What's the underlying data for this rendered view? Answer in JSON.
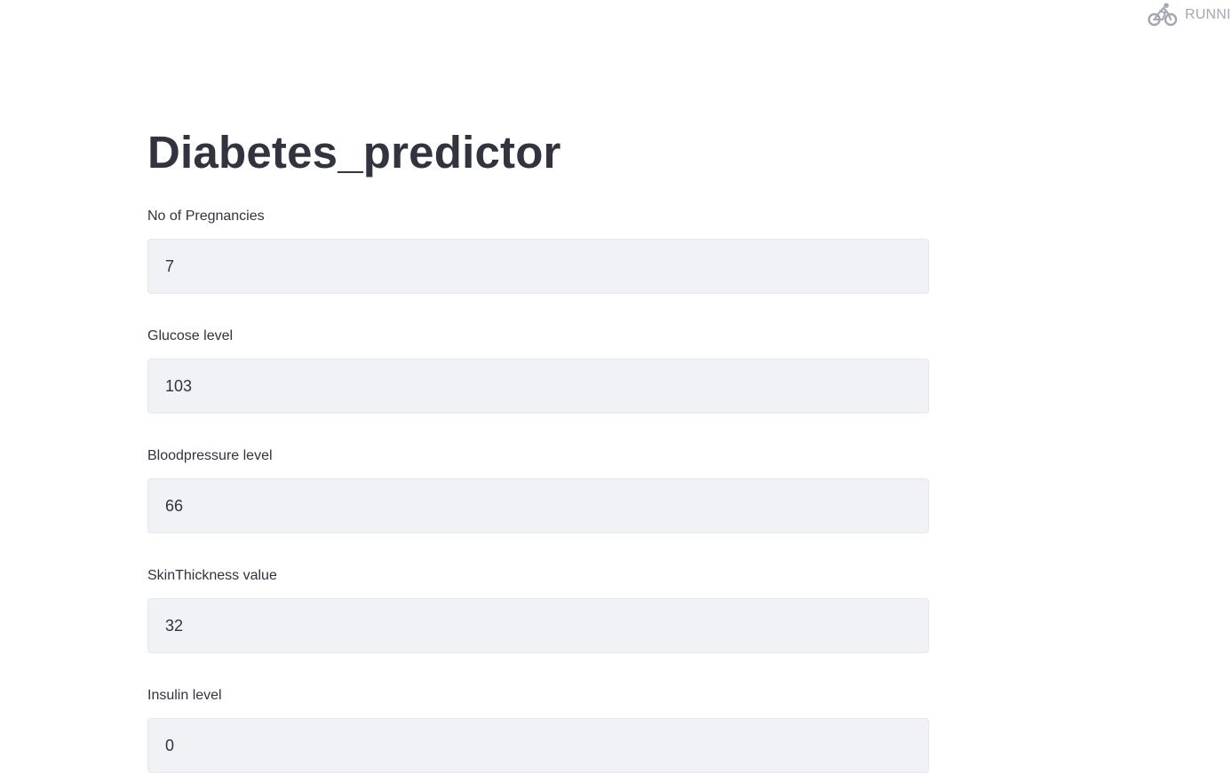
{
  "status": {
    "text": "RUNNI",
    "icon": "cyclist-icon",
    "text_color": "#a3a8b4"
  },
  "page": {
    "title": "Diabetes_predictor"
  },
  "fields": [
    {
      "label": "No of Pregnancies",
      "value": "7"
    },
    {
      "label": "Glucose level",
      "value": "103"
    },
    {
      "label": "Bloodpressure level",
      "value": "66"
    },
    {
      "label": "SkinThickness value",
      "value": "32"
    },
    {
      "label": "Insulin level",
      "value": "0"
    }
  ],
  "colors": {
    "text": "#31333f",
    "input_bg": "#f0f2f6",
    "background": "#ffffff"
  }
}
